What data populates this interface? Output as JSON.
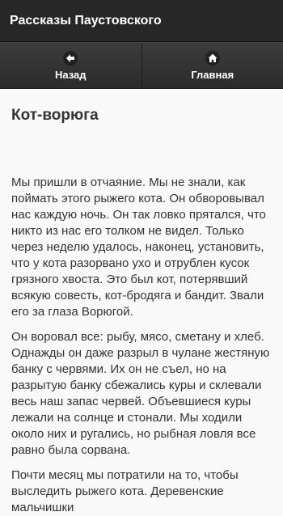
{
  "header": {
    "title": "Рассказы Паустовского"
  },
  "nav": {
    "back": {
      "label": "Назад",
      "icon": "arrow-left-icon"
    },
    "home": {
      "label": "Главная",
      "icon": "home-icon"
    }
  },
  "story": {
    "title": "Кот-ворюга",
    "paragraphs": [
      "Мы пришли в отчаяние. Мы не знали, как поймать этого рыжего кота. Он обворовывал нас каждую ночь. Он так ловко прятался, что никто из нас его толком не видел. Только через неделю удалось, наконец, установить, что у кота разорвано ухо и отрублен кусок грязного хвоста. Это был кот, потерявший всякую совесть, кот-бродяга и бандит. Звали его за глаза Ворюгой.",
      "Он воровал все: рыбу, мясо, сметану и хлеб. Однажды он даже разрыл в чулане жестяную банку с червями. Их он не съел, но на разрытую банку сбежались куры и склевали весь наш запас червей. Объевшиеся куры лежали на солнце и стонали. Мы ходили около них и ругались, но рыбная ловля все равно была сорвана.",
      "Почти месяц мы потратили на то, чтобы выследить рыжего кота. Деревенские мальчишки"
    ]
  }
}
